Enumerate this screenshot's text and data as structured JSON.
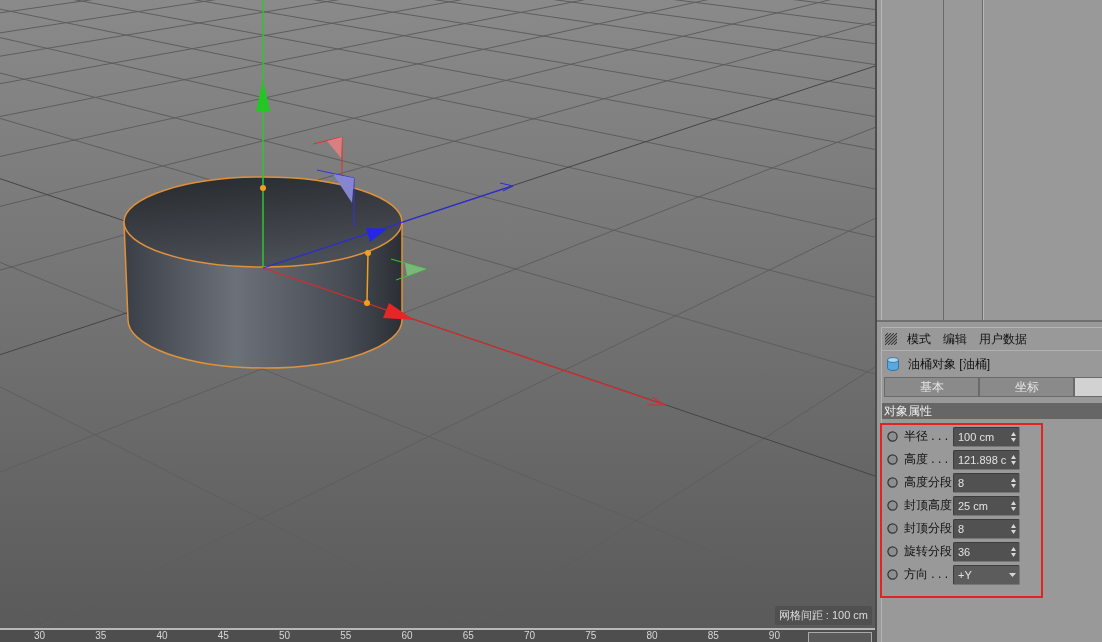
{
  "viewport": {
    "grid_spacing": "网格间距 : 100 cm"
  },
  "timeline": {
    "ticks": [
      "30",
      "35",
      "40",
      "45",
      "50",
      "55",
      "60",
      "65",
      "70",
      "75",
      "80",
      "85",
      "90"
    ]
  },
  "attributes": {
    "menu": [
      "模式",
      "编辑",
      "用户数据"
    ],
    "object_title": "油桶对象 [油桶]",
    "tabs": [
      {
        "label": "基本",
        "selected": false
      },
      {
        "label": "坐标",
        "selected": false
      },
      {
        "selected": true
      }
    ],
    "section": "对象属性",
    "params": [
      {
        "kind": "number",
        "label": "半径 . . .",
        "value": "100 cm"
      },
      {
        "kind": "number",
        "label": "高度 . . .",
        "value": "121.898 c"
      },
      {
        "kind": "number",
        "label": "高度分段",
        "value": "8"
      },
      {
        "kind": "number",
        "label": "封顶高度",
        "value": "25 cm"
      },
      {
        "kind": "number",
        "label": "封顶分段",
        "value": "8"
      },
      {
        "kind": "number",
        "label": "旋转分段",
        "value": "36"
      },
      {
        "kind": "dropdown",
        "label": "方向 . . .",
        "value": "+Y"
      }
    ]
  }
}
